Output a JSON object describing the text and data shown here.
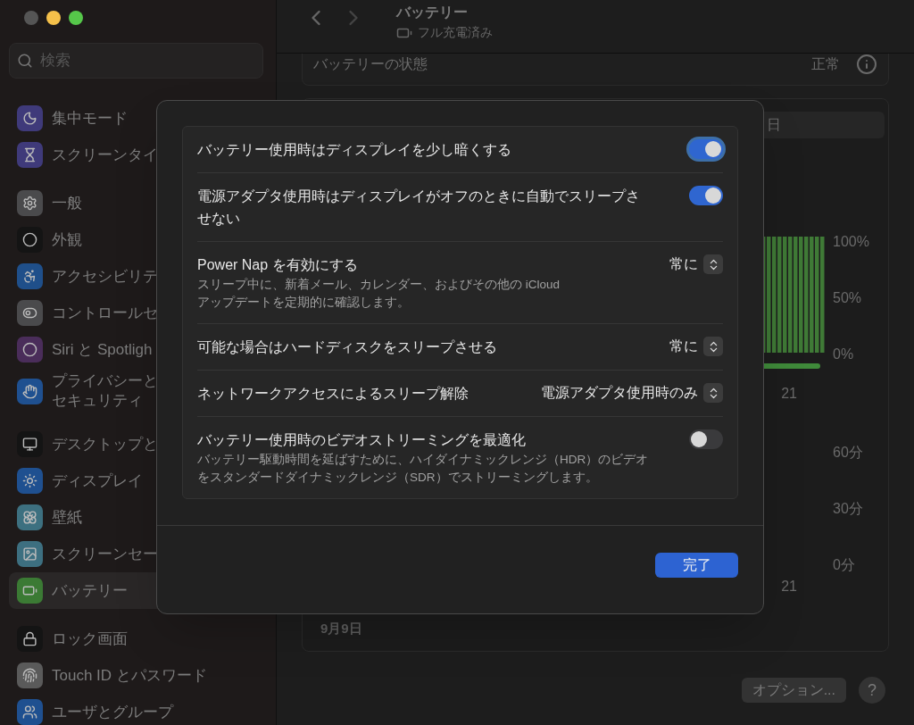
{
  "sidebar": {
    "search": {
      "placeholder": "検索"
    },
    "groups": [
      [
        {
          "label": "集中モード",
          "selected": false,
          "color": "#3f3a7a"
        },
        {
          "label": "スクリーンタイ",
          "selected": false,
          "color": "#3f3a7a"
        }
      ],
      [
        {
          "label": "一般",
          "selected": false,
          "color": "#4a4a4c"
        },
        {
          "label": "外観",
          "selected": false,
          "color": "#141414"
        },
        {
          "label": "アクセシビリテ",
          "selected": false,
          "color": "#1f4f8a"
        },
        {
          "label": "コントロールセ",
          "selected": false,
          "color": "#4a4a4c"
        },
        {
          "label": "Siri と Spotligh",
          "selected": false,
          "color": "#4a2d5a"
        },
        {
          "label": "プライバシーと",
          "label_line2": "セキュリティ",
          "selected": false,
          "color": "#1f5090"
        }
      ],
      [
        {
          "label": "デスクトップと",
          "selected": false,
          "color": "#141414"
        },
        {
          "label": "ディスプレイ",
          "selected": false,
          "color": "#1f5090"
        },
        {
          "label": "壁紙",
          "selected": false,
          "color": "#3d7080"
        },
        {
          "label": "スクリーンセー",
          "selected": false,
          "color": "#3d6f80"
        },
        {
          "label": "バッテリー",
          "selected": true,
          "color": "#3b7a34"
        }
      ],
      [
        {
          "label": "ロック画面",
          "selected": false,
          "color": "#141414"
        },
        {
          "label": "Touch ID とパスワード",
          "selected": false,
          "color": "#5a5a5a"
        },
        {
          "label": "ユーザとグループ",
          "selected": false,
          "color": "#1f5090"
        }
      ]
    ]
  },
  "header": {
    "title": "バッテリー",
    "subtitle": "フル充電済み"
  },
  "health": {
    "label": "バッテリーの状態",
    "value": "正常"
  },
  "segment": {
    "label": "日"
  },
  "level_chart": {
    "ticks": [
      "100%",
      "50%",
      "0%"
    ],
    "x_label": "21"
  },
  "usage_chart": {
    "ticks": [
      "60分",
      "30分",
      "0分"
    ],
    "x_label": "21",
    "date": "9月9日"
  },
  "footer": {
    "options_button": "オプション...",
    "help_button": "?"
  },
  "dialog": {
    "rows": [
      {
        "kind": "toggle",
        "label": "バッテリー使用時はディスプレイを少し暗くする",
        "on": true,
        "focused": true
      },
      {
        "kind": "toggle",
        "label": "電源アダプタ使用時はディスプレイがオフのときに自動でスリープさせない",
        "on": true,
        "focused": false
      },
      {
        "kind": "popup",
        "label": "Power Nap を有効にする",
        "description_lines": [
          "スリープ中に、新着メール、カレンダー、およびその他の iCloud",
          "アップデートを定期的に確認します。"
        ],
        "value": "常に"
      },
      {
        "kind": "popup",
        "label": "可能な場合はハードディスクをスリープさせる",
        "value": "常に"
      },
      {
        "kind": "popup",
        "label": "ネットワークアクセスによるスリープ解除",
        "value": "電源アダプタ使用時のみ"
      },
      {
        "kind": "toggle",
        "label": "バッテリー使用時のビデオストリーミングを最適化",
        "description_lines": [
          "バッテリー駆動時間を延ばすために、ハイダイナミックレンジ（HDR）のビデオ",
          "をスタンダードダイナミックレンジ（SDR）でストリーミングします。"
        ],
        "on": false,
        "focused": false
      }
    ],
    "done_button": "完了"
  }
}
